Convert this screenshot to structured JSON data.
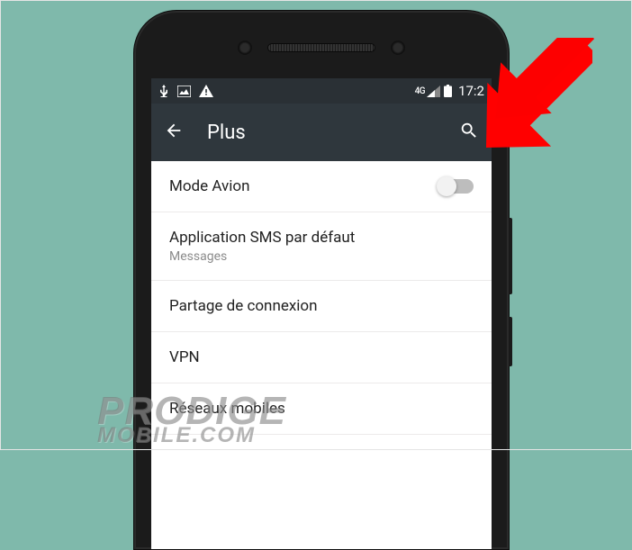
{
  "statusbar": {
    "network_label": "4G",
    "time": "17:2"
  },
  "appbar": {
    "title": "Plus"
  },
  "rows": {
    "airplane": {
      "label": "Mode Avion",
      "toggled": false
    },
    "sms": {
      "label": "Application SMS par défaut",
      "value": "Messages"
    },
    "tether": {
      "label": "Partage de connexion"
    },
    "vpn": {
      "label": "VPN"
    },
    "mobile": {
      "label": "Réseaux mobiles"
    }
  },
  "watermark": {
    "line1": "PRODIGE",
    "line2": "MOBILE.COM"
  },
  "colors": {
    "background": "#7fb9ab",
    "appbar": "#2f373d",
    "arrow": "#ff0000"
  }
}
